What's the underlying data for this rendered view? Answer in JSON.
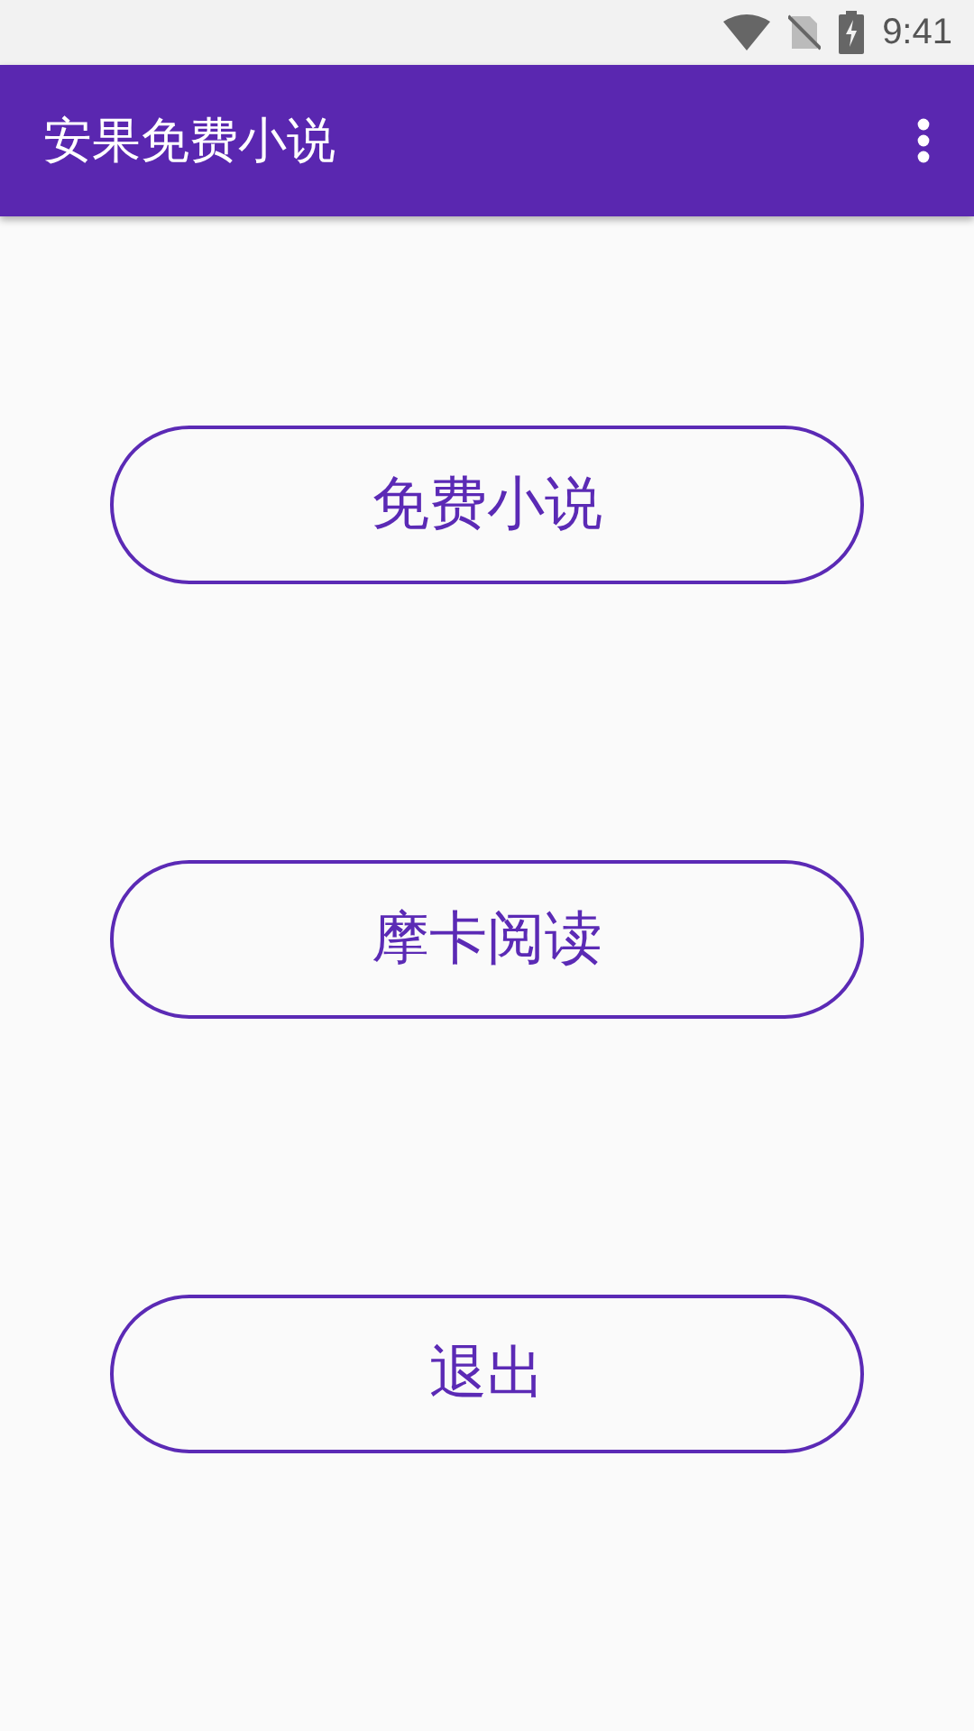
{
  "status_bar": {
    "time": "9:41"
  },
  "app_bar": {
    "title": "安果免费小说"
  },
  "buttons": [
    {
      "label": "免费小说"
    },
    {
      "label": "摩卡阅读"
    },
    {
      "label": "退出"
    }
  ]
}
